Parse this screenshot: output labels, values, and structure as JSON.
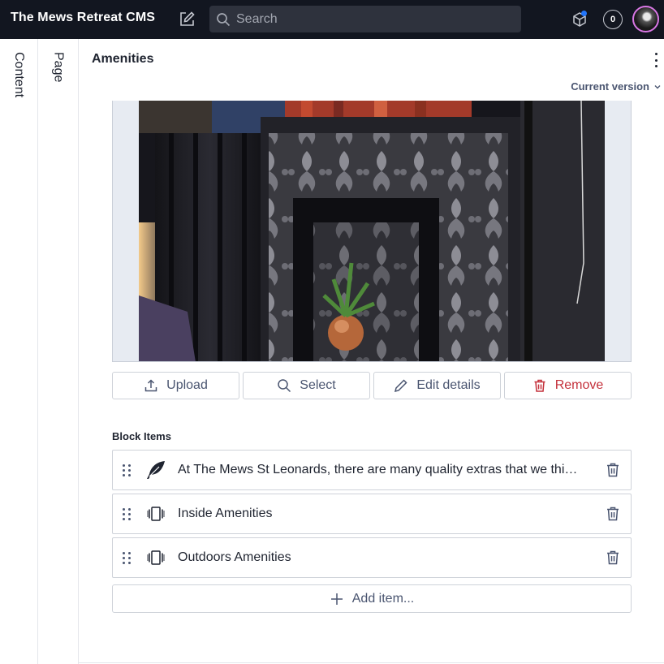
{
  "app": {
    "title": "The Mews Retreat CMS"
  },
  "search": {
    "placeholder": "Search"
  },
  "notifications": {
    "count": "0"
  },
  "tabs": {
    "content": "Content",
    "page": "Page"
  },
  "document": {
    "title": "Amenities",
    "version": "Current version"
  },
  "asset_actions": {
    "upload": "Upload",
    "select": "Select",
    "edit": "Edit details",
    "remove": "Remove"
  },
  "block_items": {
    "label": "Block Items",
    "items": [
      {
        "text": "At The Mews St Leonards, there are many quality extras that we thi…",
        "icon": "feather-icon"
      },
      {
        "text": "Inside Amenities",
        "icon": "carousel-icon"
      },
      {
        "text": "Outdoors Amenities",
        "icon": "carousel-icon"
      }
    ],
    "add_label": "Add item..."
  },
  "colors": {
    "navbar": "#121620",
    "danger": "#c4313b",
    "accent_dot": "#2276fc",
    "avatar_ring": "#d977e5"
  }
}
